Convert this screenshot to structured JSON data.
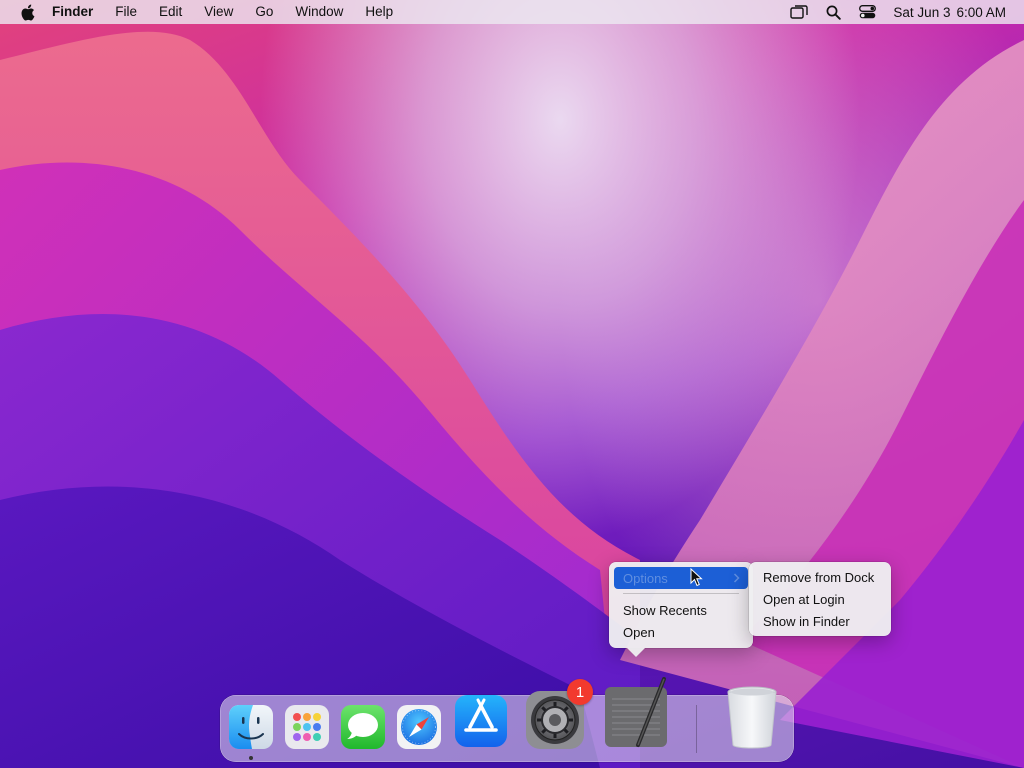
{
  "menubar": {
    "app_name": "Finder",
    "items": [
      "File",
      "Edit",
      "View",
      "Go",
      "Window",
      "Help"
    ],
    "clock_date": "Sat Jun 3",
    "clock_time": "6:00 AM"
  },
  "context_menu": {
    "items": {
      "options": "Options",
      "show_recents": "Show Recents",
      "open": "Open"
    },
    "highlighted": "Options"
  },
  "options_submenu": {
    "items": [
      "Remove from Dock",
      "Open at Login",
      "Show in Finder"
    ]
  },
  "dock": {
    "apps": [
      {
        "name": "Finder",
        "icon": "finder-icon",
        "running": true
      },
      {
        "name": "Launchpad",
        "icon": "launchpad-icon"
      },
      {
        "name": "Messages",
        "icon": "messages-icon"
      },
      {
        "name": "Safari",
        "icon": "safari-icon"
      },
      {
        "name": "App Store",
        "icon": "app-store-icon"
      },
      {
        "name": "System Preferences",
        "icon": "gear-icon",
        "badge": "1"
      },
      {
        "name": "TextEdit",
        "icon": "textedit-icon"
      },
      {
        "name": "Trash",
        "icon": "trash-icon"
      }
    ]
  },
  "colors": {
    "selection": "#1c5fd6",
    "badge": "#f23a2e"
  }
}
